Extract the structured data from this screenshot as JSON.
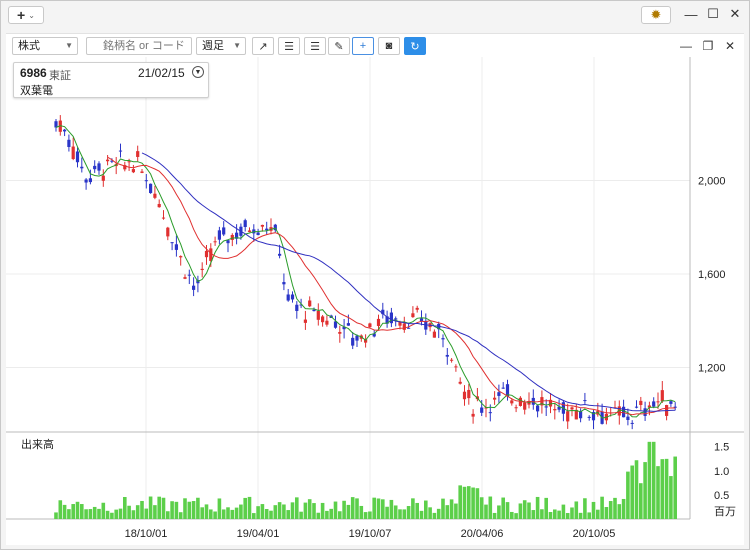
{
  "titlebar": {
    "add_label": "+"
  },
  "toolbar": {
    "type_select": "株式",
    "search_placeholder": "銘柄名 or コード",
    "period_select": "週足"
  },
  "info": {
    "code": "6986",
    "market": "東証",
    "date": "21/02/15",
    "name": "双葉電"
  },
  "volume_panel": {
    "label": "出来高",
    "unit": "百万"
  },
  "chart_data": [
    {
      "type": "candlestick",
      "price_axis_ticks": [
        "2,000",
        "1,600",
        "1,200"
      ],
      "x_tick_labels": [
        "18/10/01",
        "19/04/01",
        "19/10/07",
        "20/04/06",
        "20/10/05"
      ],
      "ylim": [
        800,
        2400
      ],
      "series": [
        {
          "name": "",
          "color": "#2a9c2a",
          "kind": "short_ma"
        },
        {
          "name": "",
          "color": "#e03030",
          "kind": "mid_ma"
        },
        {
          "name": "",
          "color": "#3030c0",
          "kind": "long_ma"
        }
      ]
    },
    {
      "type": "bar",
      "volume_axis_ticks": [
        "1.5",
        "1.0",
        "0.5"
      ],
      "ylim": [
        0,
        1.7
      ]
    }
  ],
  "colors": {
    "up": "#e03030",
    "down": "#2a35c8",
    "volume": "#5ccf4a"
  }
}
